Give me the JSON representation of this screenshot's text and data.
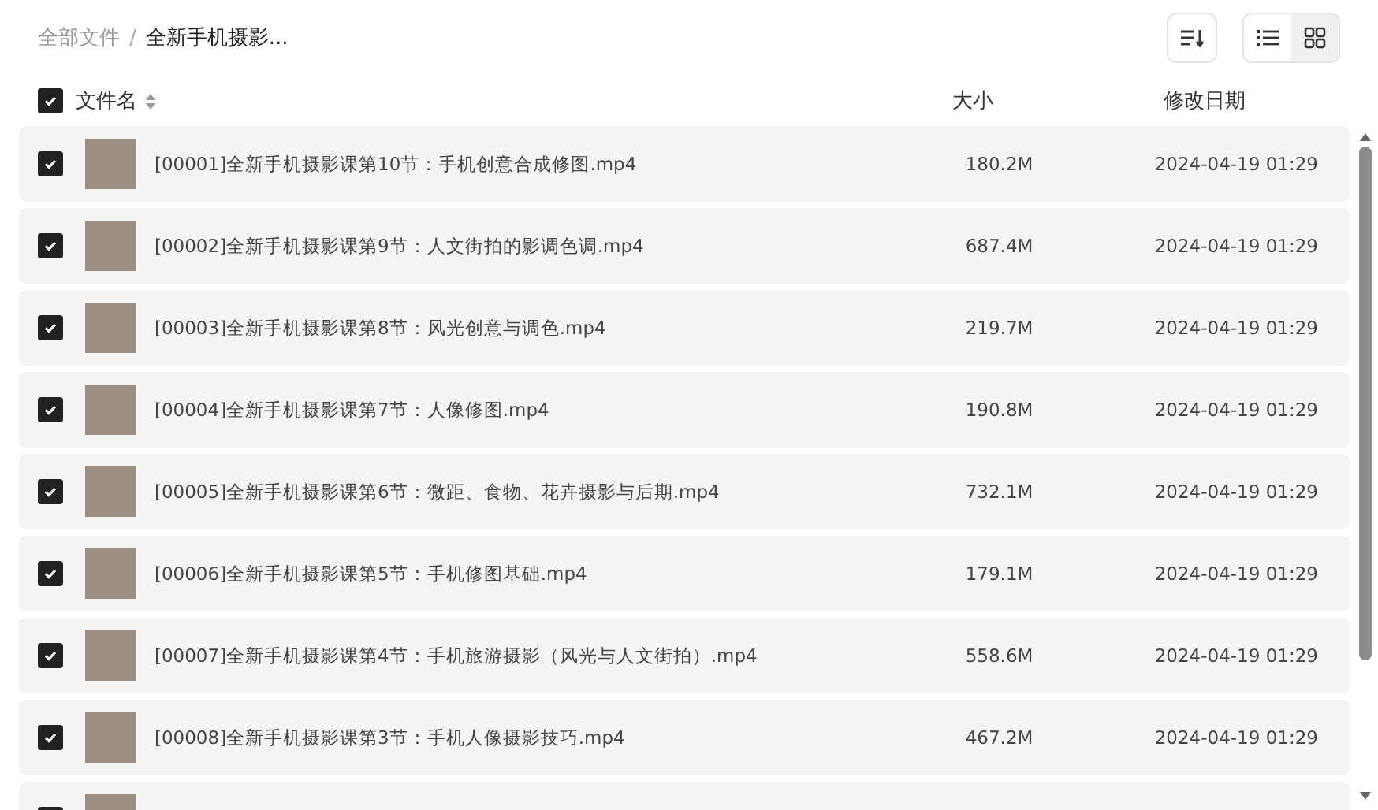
{
  "breadcrumb_separator": "/",
  "breadcrumb": [
    {
      "label": "全部文件",
      "current": false
    },
    {
      "label": "全新手机摄影...",
      "current": true
    }
  ],
  "view_options": [
    {
      "kind": "list",
      "selected": false
    },
    {
      "kind": "grid",
      "selected": true
    }
  ],
  "table": {
    "select_all": {
      "checked": true
    },
    "columns": [
      "文件名",
      "大小",
      "修改日期"
    ],
    "rows": [
      {
        "checked": true,
        "name": "[00001]全新手机摄影课第10节：手机创意合成修图.mp4",
        "size": "180.2M",
        "modified": "2024-04-19 01:29"
      },
      {
        "checked": true,
        "name": "[00002]全新手机摄影课第9节：人文街拍的影调色调.mp4",
        "size": "687.4M",
        "modified": "2024-04-19 01:29"
      },
      {
        "checked": true,
        "name": "[00003]全新手机摄影课第8节：风光创意与调色.mp4",
        "size": "219.7M",
        "modified": "2024-04-19 01:29"
      },
      {
        "checked": true,
        "name": "[00004]全新手机摄影课第7节：人像修图.mp4",
        "size": "190.8M",
        "modified": "2024-04-19 01:29"
      },
      {
        "checked": true,
        "name": "[00005]全新手机摄影课第6节：微距、食物、花卉摄影与后期.mp4",
        "size": "732.1M",
        "modified": "2024-04-19 01:29"
      },
      {
        "checked": true,
        "name": "[00006]全新手机摄影课第5节：手机修图基础.mp4",
        "size": "179.1M",
        "modified": "2024-04-19 01:29"
      },
      {
        "checked": true,
        "name": "[00007]全新手机摄影课第4节：手机旅游摄影（风光与人文街拍）.mp4",
        "size": "558.6M",
        "modified": "2024-04-19 01:29"
      },
      {
        "checked": true,
        "name": "[00008]全新手机摄影课第3节：手机人像摄影技巧.mp4",
        "size": "467.2M",
        "modified": "2024-04-19 01:29"
      },
      {
        "checked": true
      }
    ]
  }
}
